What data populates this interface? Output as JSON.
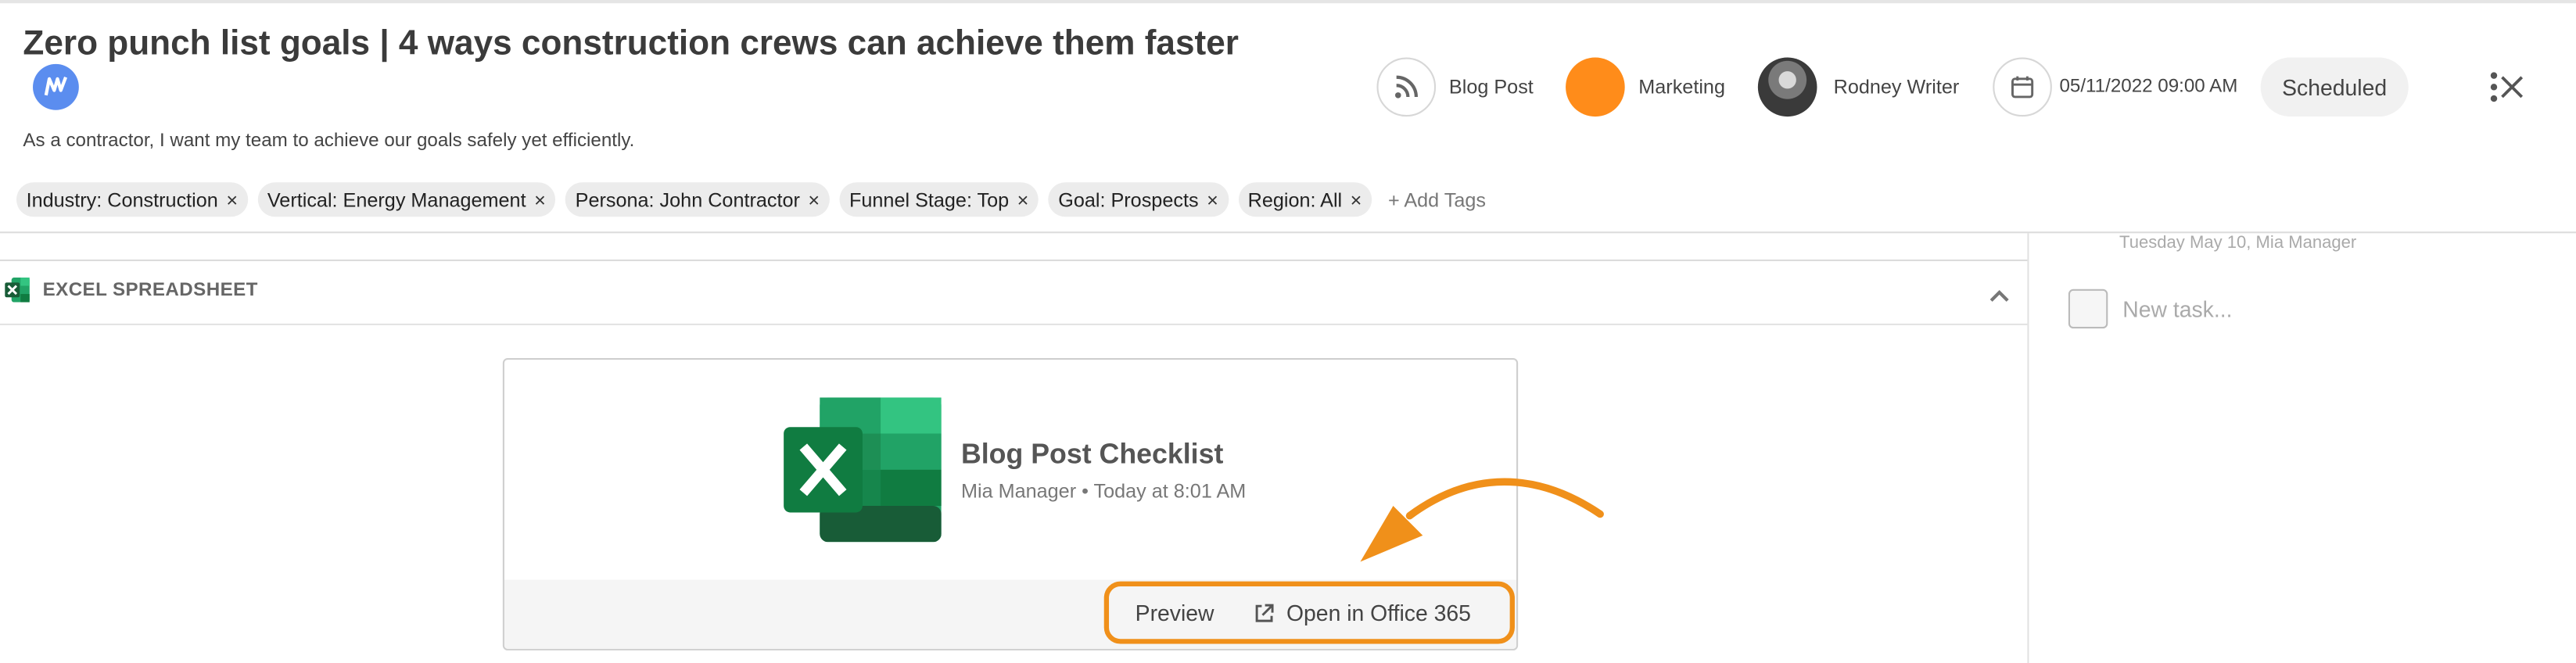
{
  "header": {
    "title": "Zero punch list goals | 4 ways construction crews can achieve them faster",
    "subtitle": "As a contractor, I want my team to achieve our goals safely yet efficiently."
  },
  "meta": {
    "content_type": "Blog Post",
    "category": "Marketing",
    "category_color": "#ff8c1a",
    "author": "Rodney Writer",
    "datetime": "05/11/2022 09:00 AM",
    "status": "Scheduled"
  },
  "tags": {
    "items": [
      {
        "label": "Industry: Construction"
      },
      {
        "label": "Vertical: Energy Management"
      },
      {
        "label": "Persona: John Contractor"
      },
      {
        "label": "Funnel Stage: Top"
      },
      {
        "label": "Goal: Prospects"
      },
      {
        "label": "Region: All"
      }
    ],
    "remove_glyph": "×",
    "add_label": "+ Add Tags"
  },
  "section": {
    "title": "EXCEL SPREADSHEET"
  },
  "attachment": {
    "title": "Blog Post Checklist",
    "meta": "Mia Manager  • Today at 8:01 AM",
    "preview_label": "Preview",
    "open_label": "Open in Office 365",
    "highlight_color": "#f0901a"
  },
  "tasks": {
    "previous_meta": "Tuesday May 10,  Mia Manager",
    "new_task_placeholder": "New task..."
  },
  "icons": {
    "content_type": "rss-icon",
    "date": "calendar-icon",
    "more": "kebab-icon",
    "close": "close-icon",
    "collapse": "chevron-up-icon",
    "external": "external-link-icon"
  }
}
